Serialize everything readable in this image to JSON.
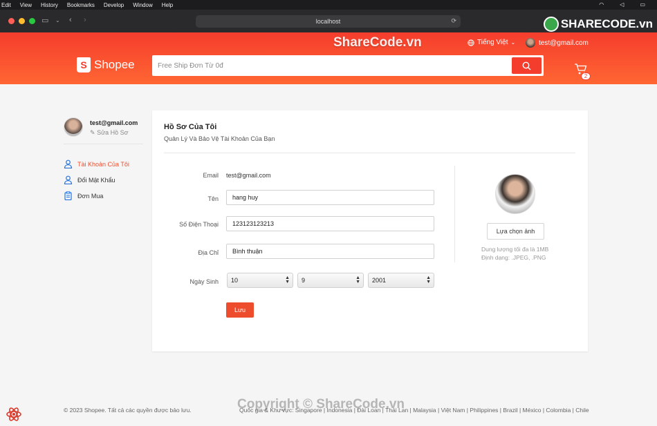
{
  "menubar": {
    "items": [
      "Edit",
      "View",
      "History",
      "Bookmarks",
      "Develop",
      "Window",
      "Help"
    ]
  },
  "browser": {
    "address": "localhost"
  },
  "watermark": {
    "logo_text": "SHARECODE.vn",
    "top_text": "ShareCode.vn",
    "bottom_text": "Copyright © ShareCode.vn"
  },
  "header": {
    "language": "Tiếng Việt",
    "user_email": "test@gmail.com",
    "logo_text": "Shopee",
    "search": {
      "placeholder": "Free Ship Đơn Từ 0đ",
      "value": ""
    },
    "cart_count": "2"
  },
  "sidebar": {
    "email": "test@gmail.com",
    "edit_label": "Sửa Hồ Sơ",
    "items": [
      {
        "label": "Tài Khoản Của Tôi",
        "icon": "user-icon"
      },
      {
        "label": "Đổi Mật Khẩu",
        "icon": "user-icon"
      },
      {
        "label": "Đơn Mua",
        "icon": "clipboard-icon"
      }
    ]
  },
  "profile": {
    "title": "Hồ Sơ Của Tôi",
    "subtitle": "Quản Lý Và Bảo Vệ Tài Khoản Của Bạn",
    "email_label": "Email",
    "email_value": "test@gmail.com",
    "name_label": "Tên",
    "name_value": "hang huy",
    "phone_label": "Số Điện Thoại",
    "phone_value": "123123123213",
    "address_label": "Địa Chỉ",
    "address_value": "Bình thuận",
    "dob_label": "Ngày Sinh",
    "dob_day": "10",
    "dob_month": "9",
    "dob_year": "2001",
    "save_label": "Lưu",
    "choose_image_label": "Lựa chọn ảnh",
    "size_hint": "Dung lượng tối đa là 1MB",
    "format_hint": "Định dạng: .JPEG, .PNG"
  },
  "footer": {
    "copyright": "© 2023 Shopee. Tất cả các quyền được bảo lưu.",
    "countries": "Quốc gia & Khu vực: Singapore | Indonesia | Đài Loan | Thái Lan | Malaysia | Việt Nam | Philippines | Brazil | México | Colombia | Chile"
  },
  "colors": {
    "brand": "#ee4d2d",
    "header_start": "#f53d2d",
    "header_end": "#ff6633"
  }
}
